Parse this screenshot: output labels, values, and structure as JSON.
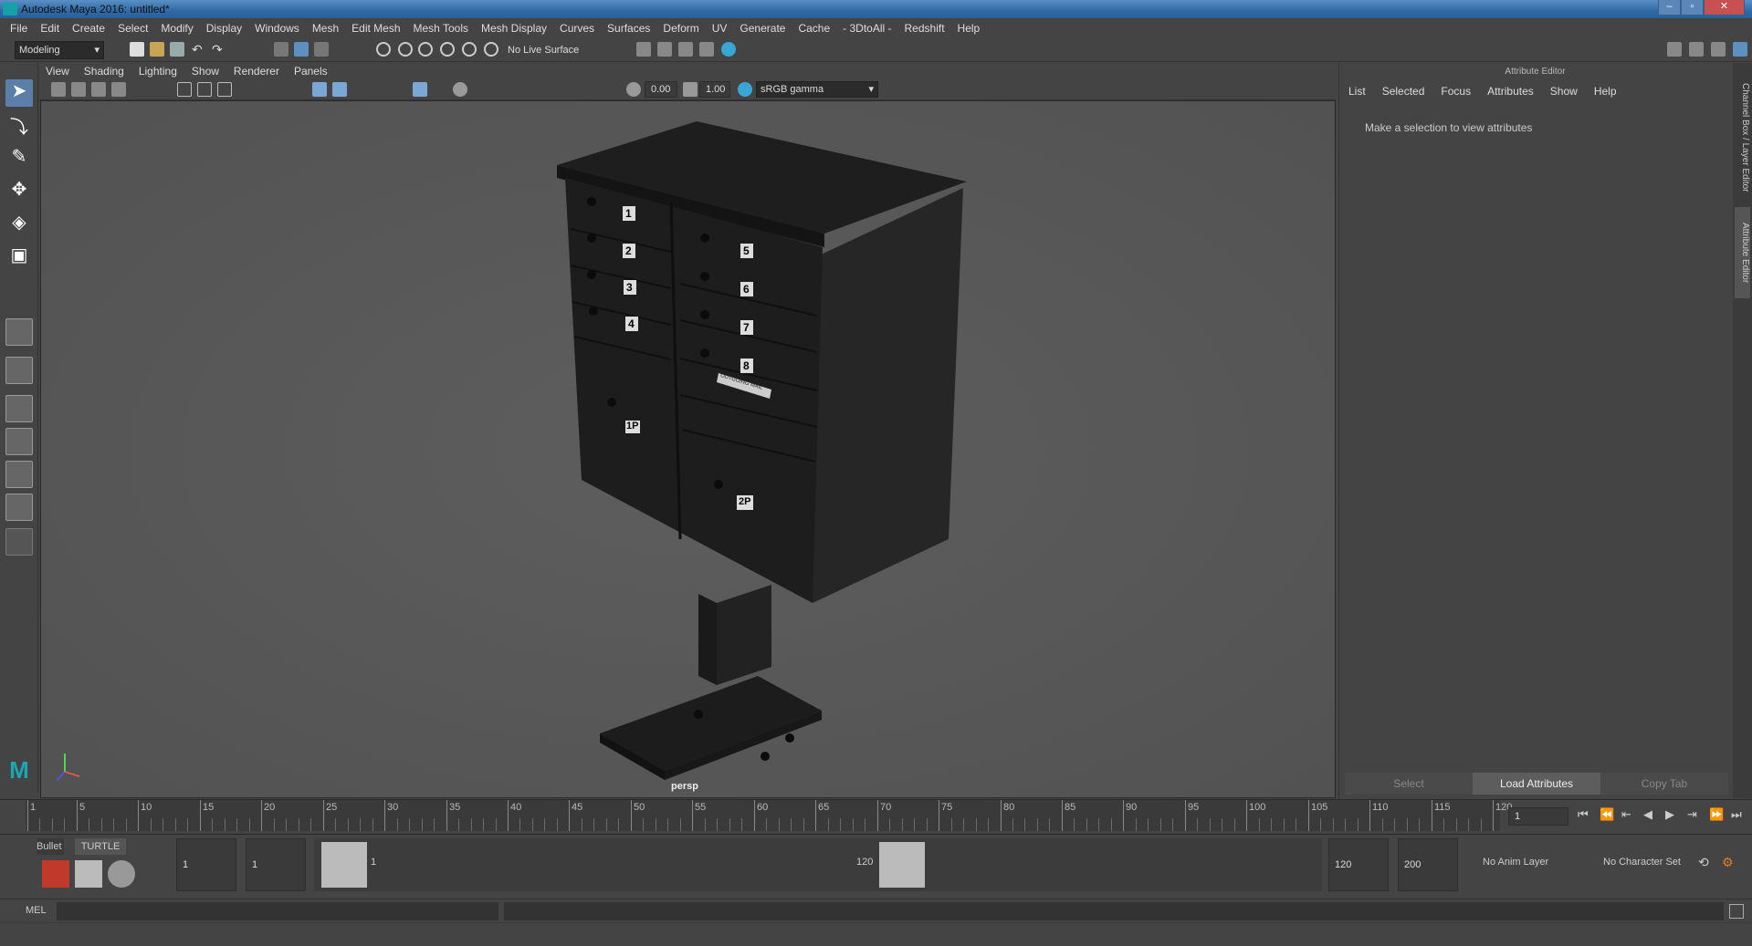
{
  "window": {
    "title": "Autodesk Maya 2016: untitled*"
  },
  "menubar": [
    "File",
    "Edit",
    "Create",
    "Select",
    "Modify",
    "Display",
    "Windows",
    "Mesh",
    "Edit Mesh",
    "Mesh Tools",
    "Mesh Display",
    "Curves",
    "Surfaces",
    "Deform",
    "UV",
    "Generate",
    "Cache",
    "- 3DtoAll -",
    "Redshift",
    "Help"
  ],
  "toolbar": {
    "mode": "Modeling",
    "live_surface": "No Live Surface"
  },
  "panel_menu": [
    "View",
    "Shading",
    "Lighting",
    "Show",
    "Renderer",
    "Panels"
  ],
  "viewport_toolbar": {
    "exposure": "0.00",
    "gamma": "1.00",
    "color_space": "sRGB gamma"
  },
  "viewport": {
    "camera_label": "persp"
  },
  "mailbox": {
    "left_doors": [
      "1",
      "2",
      "3",
      "4"
    ],
    "right_doors": [
      "5",
      "6",
      "7",
      "8"
    ],
    "parcel_left": "1P",
    "parcel_right": "2P",
    "outgoing_label": "OUTGOING MAIL"
  },
  "attribute_editor": {
    "header": "Attribute Editor",
    "menu": [
      "List",
      "Selected",
      "Focus",
      "Attributes",
      "Show",
      "Help"
    ],
    "message": "Make a selection to view attributes",
    "buttons": {
      "select": "Select",
      "load": "Load Attributes",
      "copy": "Copy Tab"
    }
  },
  "side_tabs": {
    "channel_box": "Channel Box / Layer Editor",
    "attribute_editor": "Attribute Editor"
  },
  "timeline": {
    "labels": [
      "1",
      "5",
      "10",
      "15",
      "20",
      "25",
      "30",
      "35",
      "40",
      "45",
      "50",
      "55",
      "60",
      "65",
      "70",
      "75",
      "80",
      "85",
      "90",
      "95",
      "100",
      "105",
      "110",
      "115",
      "120"
    ],
    "current_frame": "1"
  },
  "range": {
    "shelf_tabs": [
      "Bullet",
      "TURTLE"
    ],
    "start": "1",
    "playback_start": "1",
    "slider_start_label": "1",
    "slider_end_label": "120",
    "playback_end": "120",
    "end": "200",
    "anim_layer": "No Anim Layer",
    "character_set": "No Character Set"
  },
  "cmdline": {
    "label": "MEL"
  }
}
